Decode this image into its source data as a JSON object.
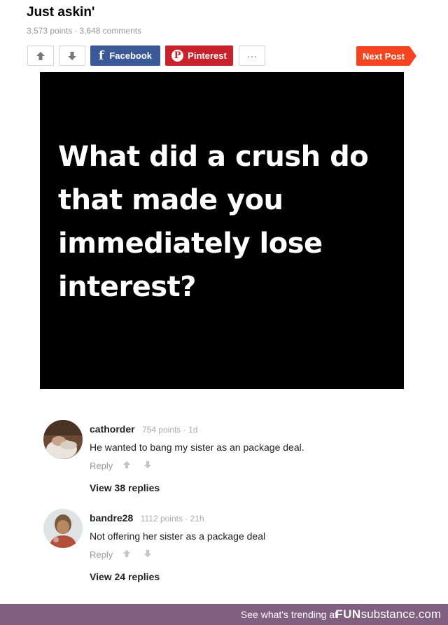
{
  "post": {
    "title": "Just askin'",
    "points": "3,573 points",
    "separator": "·",
    "comments": "3,648 comments"
  },
  "toolbar": {
    "facebook_label": "Facebook",
    "pinterest_label": "Pinterest",
    "more_label": "···",
    "next_label": "Next Post"
  },
  "image_text": "What did a crush do that made you immediately lose interest?",
  "comments": [
    {
      "user": "cathorder",
      "points": "754 points · 1d",
      "text": "He wanted to bang my sister as an package deal.",
      "reply_label": "Reply",
      "replies": "View 38 replies"
    },
    {
      "user": "bandre28",
      "points": "1112 points · 21h",
      "text": "Not offering her sister as a package deal",
      "reply_label": "Reply",
      "replies": "View 24 replies"
    }
  ],
  "footer": {
    "trend_text": "See what's trending at",
    "brand_bold": "FUN",
    "brand_rest": "substance.com"
  },
  "colors": {
    "facebook": "#3b5998",
    "pinterest": "#c8232c",
    "next_post": "#f5441f",
    "footer": "#805f80"
  }
}
